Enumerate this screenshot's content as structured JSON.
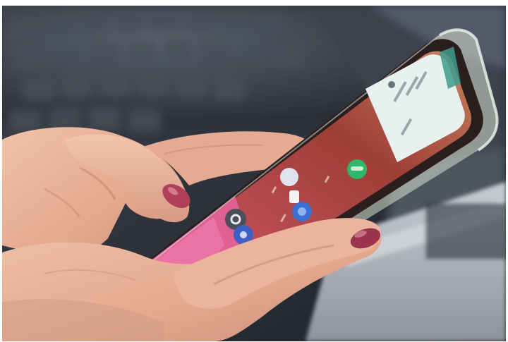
{
  "photo": {
    "subject": "hands-holding-smartphone",
    "colors": {
      "laptop_keyboard": "#2f3440",
      "laptop_body": "#b9bcc3",
      "skin": "#e9b49a",
      "skin_shadow": "#b9786a",
      "nail_polish": "#b0405a",
      "phone_bezel": "#2a1e1e",
      "wallpaper_pink": "#e05a93",
      "wallpaper_red": "#a8483e",
      "notification_card": "#e8f0f0",
      "clear_case": "#d8e2cf",
      "accent_green": "#2fb86a",
      "accent_teal": "#3d9c8c"
    },
    "icons": [
      "settings-icon",
      "app-icon",
      "app-icon",
      "app-icon",
      "app-icon",
      "toggle-icon"
    ]
  }
}
